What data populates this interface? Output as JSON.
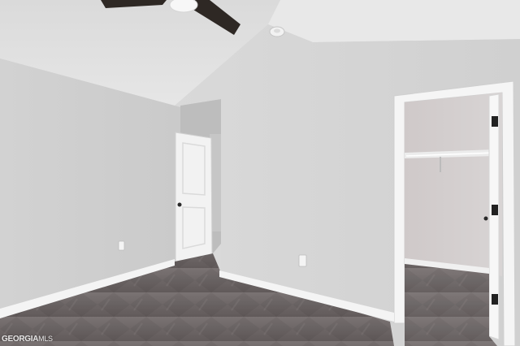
{
  "photo": {
    "subject": "empty-bedroom-with-walk-in-closet",
    "colors": {
      "wall": "#d6d6d6",
      "ceiling": "#e4e4e4",
      "carpet": "#6e6868",
      "trim": "#f4f4f4",
      "fan_blade": "#2e2824",
      "hinge": "#222222"
    }
  },
  "watermark": {
    "brand": "GEORGIA",
    "suffix": "MLS"
  }
}
